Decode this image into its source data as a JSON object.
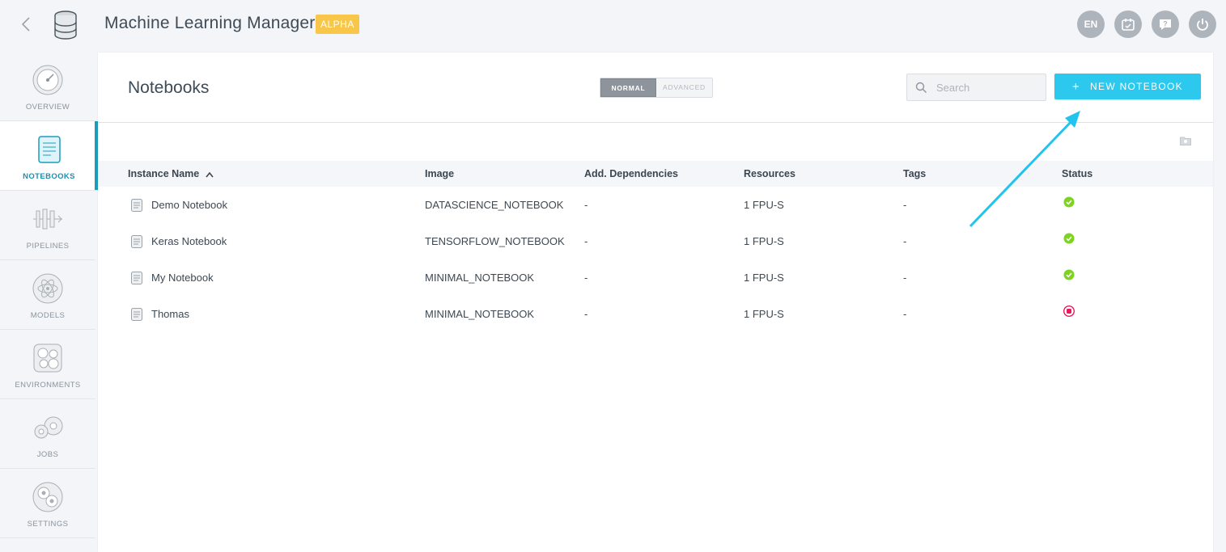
{
  "header": {
    "title": "Machine Learning Manager",
    "badge": "ALPHA",
    "language": "EN",
    "actions": [
      "calendar-icon",
      "help-icon",
      "power-icon"
    ]
  },
  "sidebar": {
    "items": [
      {
        "label": "OVERVIEW",
        "icon": "overview-gauge-icon",
        "active": false
      },
      {
        "label": "NOTEBOOKS",
        "icon": "notebook-icon",
        "active": true
      },
      {
        "label": "PIPELINES",
        "icon": "pipelines-icon",
        "active": false
      },
      {
        "label": "MODELS",
        "icon": "models-atom-icon",
        "active": false
      },
      {
        "label": "ENVIRONMENTS",
        "icon": "environments-icon",
        "active": false
      },
      {
        "label": "JOBS",
        "icon": "jobs-icon",
        "active": false
      },
      {
        "label": "SETTINGS",
        "icon": "settings-gear-icon",
        "active": false
      }
    ]
  },
  "page": {
    "title": "Notebooks",
    "mode": {
      "normal": "NORMAL",
      "advanced": "ADVANCED",
      "selected": "NORMAL"
    },
    "search": {
      "placeholder": "Search",
      "value": ""
    },
    "new_button": "NEW NOTEBOOK"
  },
  "table": {
    "columns": [
      "Instance Name",
      "Image",
      "Add. Dependencies",
      "Resources",
      "Tags",
      "Status"
    ],
    "sorted_by": "Instance Name",
    "rows": [
      {
        "name": "Demo Notebook",
        "image": "DATASCIENCE_NOTEBOOK",
        "deps": "-",
        "resources": "1 FPU-S",
        "tags": "-",
        "status": "running"
      },
      {
        "name": "Keras Notebook",
        "image": "TENSORFLOW_NOTEBOOK",
        "deps": "-",
        "resources": "1 FPU-S",
        "tags": "-",
        "status": "running"
      },
      {
        "name": "My Notebook",
        "image": "MINIMAL_NOTEBOOK",
        "deps": "-",
        "resources": "1 FPU-S",
        "tags": "-",
        "status": "running"
      },
      {
        "name": "Thomas",
        "image": "MINIMAL_NOTEBOOK",
        "deps": "-",
        "resources": "1 FPU-S",
        "tags": "-",
        "status": "stopped"
      }
    ]
  },
  "colors": {
    "accent": "#2cc8ee",
    "active_nav": "#1a9dbd",
    "status_ok": "#7ed321",
    "status_stopped": "#e8195e",
    "badge": "#f8c74a"
  }
}
